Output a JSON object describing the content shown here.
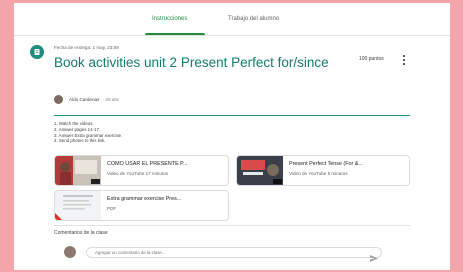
{
  "tabs": [
    {
      "label": "Instrucciones",
      "active": true
    },
    {
      "label": "Trabajo del alumno",
      "active": false
    }
  ],
  "assignment": {
    "icon": "assignment-icon",
    "due": "Fecha de entrega: 1 may, 23:59",
    "title": "Book activities unit 2 Present Perfect for/since",
    "points": "100 puntos",
    "author": "Aldo Cardenas",
    "date": "28 abr.",
    "instructions": [
      "1. Watch the videos.",
      "2. Answer pages 14-17.",
      "3. Answer Extra grammar exercise.",
      "4. Send photos to this link."
    ]
  },
  "attachments": [
    {
      "title": "CÓMO USAR EL PRESENTE P...",
      "subtitle": "Video de YouTube   17 minutos",
      "kind": "youtube-video"
    },
    {
      "title": "Present Perfect Tense (For &...",
      "subtitle": "Video de YouTube   5 minutos",
      "kind": "youtube-video"
    },
    {
      "title": "Extra grammar exercise Pres...",
      "subtitle": "PDF",
      "kind": "pdf"
    }
  ],
  "comments": {
    "label": "Comentarios de la clase",
    "placeholder": "Agregar un comentario de la clase..."
  },
  "colors": {
    "accent": "#1e8e7e",
    "title": "#137c6e",
    "background": "#f4a5aa"
  }
}
